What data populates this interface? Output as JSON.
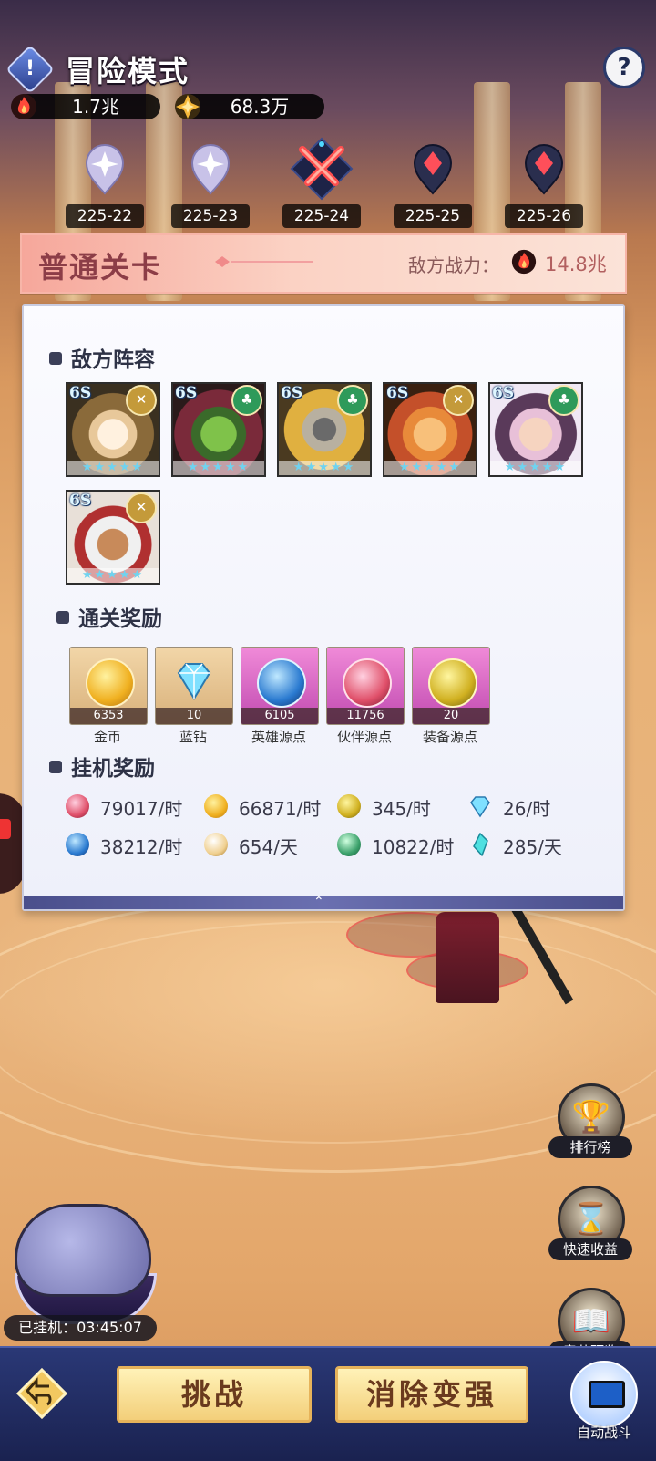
{
  "header": {
    "title": "冒险模式",
    "info_icon": "exclamation-icon",
    "help_label": "?"
  },
  "resources": [
    {
      "icon": "fire-power-icon",
      "value": "1.7兆"
    },
    {
      "icon": "gold-star-icon",
      "value": "68.3万"
    }
  ],
  "stages": [
    {
      "label": "225-22",
      "state": "cleared"
    },
    {
      "label": "225-23",
      "state": "cleared"
    },
    {
      "label": "225-24",
      "state": "current"
    },
    {
      "label": "225-25",
      "state": "locked"
    },
    {
      "label": "225-26",
      "state": "locked"
    }
  ],
  "stage_banner": {
    "title": "普通关卡",
    "enemy_power_label": "敌方战力：",
    "enemy_power_value": "14.8兆"
  },
  "enemy_lineup": {
    "title": "敌方阵容",
    "heroes": [
      {
        "level": "6S",
        "faction": "light",
        "faction_icon": "crossed-swords-icon",
        "stars": "★★★★★"
      },
      {
        "level": "6S",
        "faction": "nature",
        "faction_icon": "tree-icon",
        "stars": "★★★★★"
      },
      {
        "level": "6S",
        "faction": "nature",
        "faction_icon": "tree-icon",
        "stars": "★★★★★"
      },
      {
        "level": "6S",
        "faction": "light",
        "faction_icon": "crossed-swords-icon",
        "stars": "★★★★★"
      },
      {
        "level": "6S",
        "faction": "nature",
        "faction_icon": "tree-icon",
        "stars": "★★★★★"
      },
      {
        "level": "6S",
        "faction": "light",
        "faction_icon": "crossed-swords-icon",
        "stars": "★★★★★"
      }
    ]
  },
  "clear_rewards": {
    "title": "通关奖励",
    "items": [
      {
        "name": "金币",
        "count": "6353",
        "icon": "gold-coin-icon"
      },
      {
        "name": "蓝钻",
        "count": "10",
        "icon": "blue-diamond-icon"
      },
      {
        "name": "英雄源点",
        "count": "6105",
        "icon": "hero-essence-icon"
      },
      {
        "name": "伙伴源点",
        "count": "11756",
        "icon": "partner-essence-icon"
      },
      {
        "name": "装备源点",
        "count": "20",
        "icon": "equipment-essence-icon"
      }
    ]
  },
  "idle_rewards": {
    "title": "挂机奖励",
    "items": [
      {
        "value": "79017/时",
        "icon": "partner-essence-icon"
      },
      {
        "value": "66871/时",
        "icon": "gold-coin-icon"
      },
      {
        "value": "345/时",
        "icon": "equipment-essence-icon"
      },
      {
        "value": "26/时",
        "icon": "blue-diamond-icon"
      },
      {
        "value": "38212/时",
        "icon": "hero-essence-icon"
      },
      {
        "value": "654/天",
        "icon": "compass-orb-icon"
      },
      {
        "value": "10822/时",
        "icon": "temple-icon"
      },
      {
        "value": "285/天",
        "icon": "crystal-shard-icon"
      }
    ]
  },
  "side_buttons": [
    {
      "label": "排行榜",
      "icon": "trophy-icon"
    },
    {
      "label": "快速收益",
      "icon": "hourglass-icon"
    },
    {
      "label": "章节预览",
      "icon": "book-icon"
    }
  ],
  "idle_status": {
    "label": "已挂机：03:45:07"
  },
  "bottom_bar": {
    "back_icon": "back-arrow-icon",
    "challenge_label": "挑战",
    "strengthen_label": "消除变强",
    "auto_battle_label": "自动战斗"
  },
  "colors": {
    "banner_title": "#8c3d47",
    "panel_bg": "#f6f7fd",
    "button_gold": "#f3cf7a",
    "bottom_bar": "#1a2250"
  }
}
